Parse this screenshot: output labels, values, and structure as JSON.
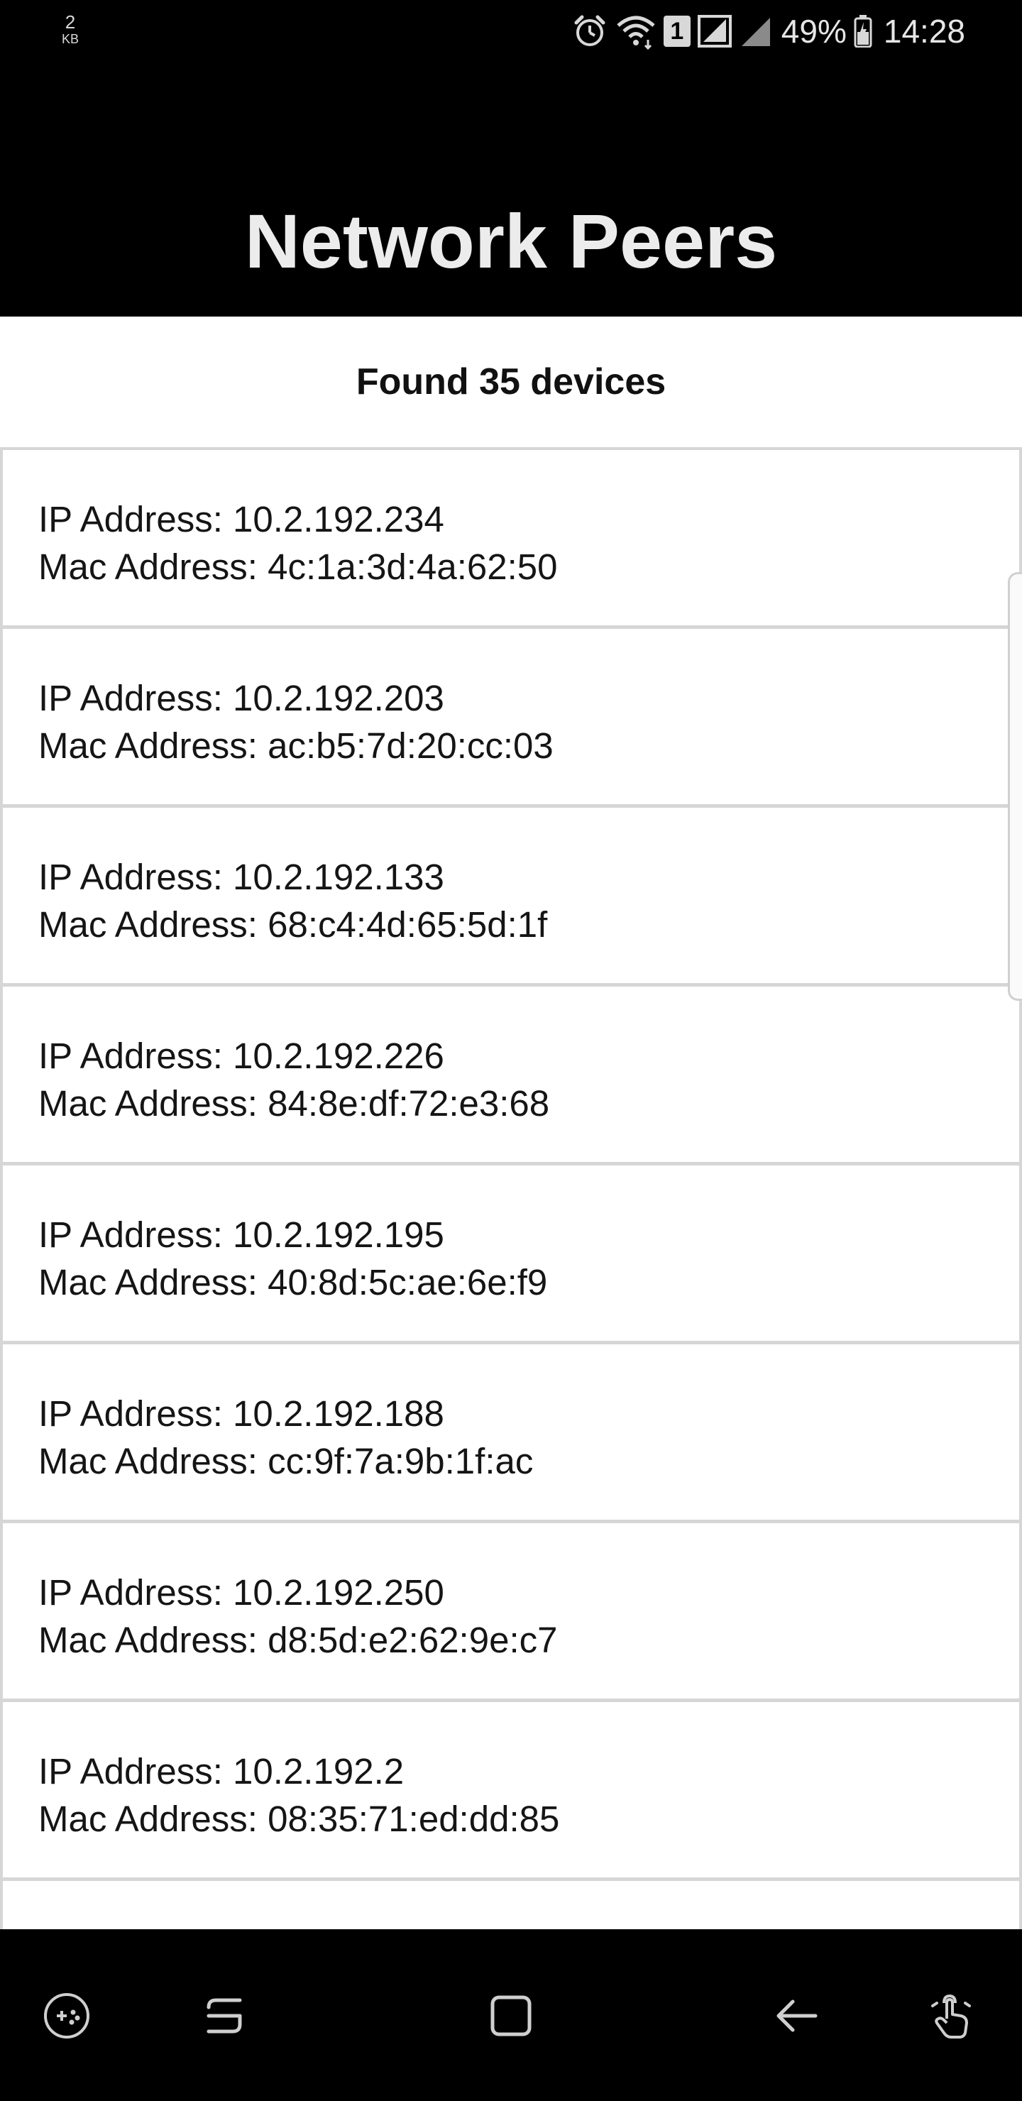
{
  "status_bar": {
    "net_speed_value": "2",
    "net_speed_unit": "KB",
    "battery_percent": "49%",
    "time": "14:28",
    "sim_label": "1",
    "icons": [
      "alarm-icon",
      "wifi-icon",
      "sim-icon",
      "signal-icon",
      "signal-icon-2",
      "battery-icon"
    ]
  },
  "header": {
    "title": "Network Peers"
  },
  "summary": {
    "count_text": "Found 35 devices"
  },
  "devices": [
    {
      "ip": "IP Address: 10.2.192.234",
      "mac": "Mac Address: 4c:1a:3d:4a:62:50"
    },
    {
      "ip": "IP Address: 10.2.192.203",
      "mac": "Mac Address: ac:b5:7d:20:cc:03"
    },
    {
      "ip": "IP Address: 10.2.192.133",
      "mac": "Mac Address: 68:c4:4d:65:5d:1f"
    },
    {
      "ip": "IP Address: 10.2.192.226",
      "mac": "Mac Address: 84:8e:df:72:e3:68"
    },
    {
      "ip": "IP Address: 10.2.192.195",
      "mac": "Mac Address: 40:8d:5c:ae:6e:f9"
    },
    {
      "ip": "IP Address: 10.2.192.188",
      "mac": "Mac Address: cc:9f:7a:9b:1f:ac"
    },
    {
      "ip": "IP Address: 10.2.192.250",
      "mac": "Mac Address: d8:5d:e2:62:9e:c7"
    },
    {
      "ip": "IP Address: 10.2.192.2",
      "mac": "Mac Address: 08:35:71:ed:dd:85"
    },
    {
      "ip": "",
      "mac": ""
    }
  ],
  "nav_bar": {
    "icons": [
      "game-tools-icon",
      "recents-icon",
      "home-icon",
      "back-icon",
      "touch-assist-icon"
    ]
  },
  "colors": {
    "bar_background": "#000000",
    "title_text": "#ececec",
    "list_border": "#d6d6d6",
    "body_text": "#151515"
  }
}
